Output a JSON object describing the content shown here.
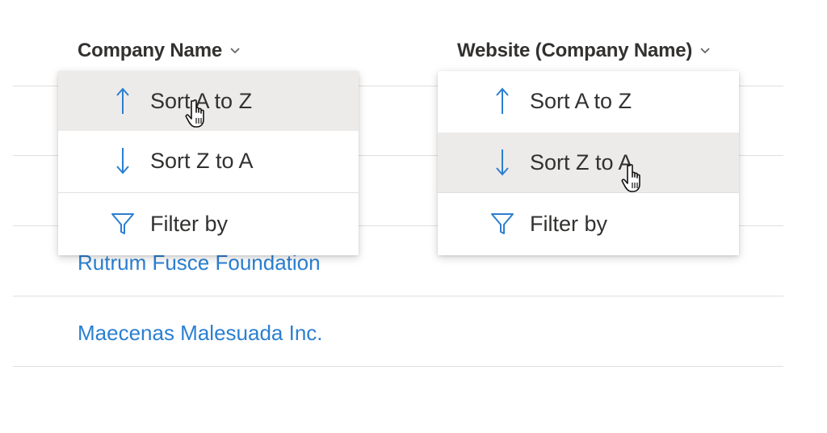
{
  "columns": {
    "company_name": {
      "label": "Company Name",
      "icon": "chevron-down-icon"
    },
    "website": {
      "label": "Website (Company Name)",
      "icon": "chevron-down-icon"
    }
  },
  "rows": [
    {
      "company_name": "Rutrum Fusce Foundation"
    },
    {
      "company_name": "Maecenas Malesuada Inc."
    }
  ],
  "company_menu": {
    "items": [
      {
        "label": "Sort A to Z",
        "icon": "arrow-up-icon",
        "hovered": true
      },
      {
        "label": "Sort Z to A",
        "icon": "arrow-down-icon",
        "hovered": false
      },
      {
        "label": "Filter by",
        "icon": "filter-icon",
        "hovered": false
      }
    ]
  },
  "website_menu": {
    "items": [
      {
        "label": "Sort A to Z",
        "icon": "arrow-up-icon",
        "hovered": false
      },
      {
        "label": "Sort Z to A",
        "icon": "arrow-down-icon",
        "hovered": true
      },
      {
        "label": "Filter by",
        "icon": "filter-icon",
        "hovered": false
      }
    ]
  },
  "colors": {
    "accent": "#2b7fd1",
    "text": "#323130",
    "hover": "#edebe9",
    "divider": "#e1dfdd"
  }
}
